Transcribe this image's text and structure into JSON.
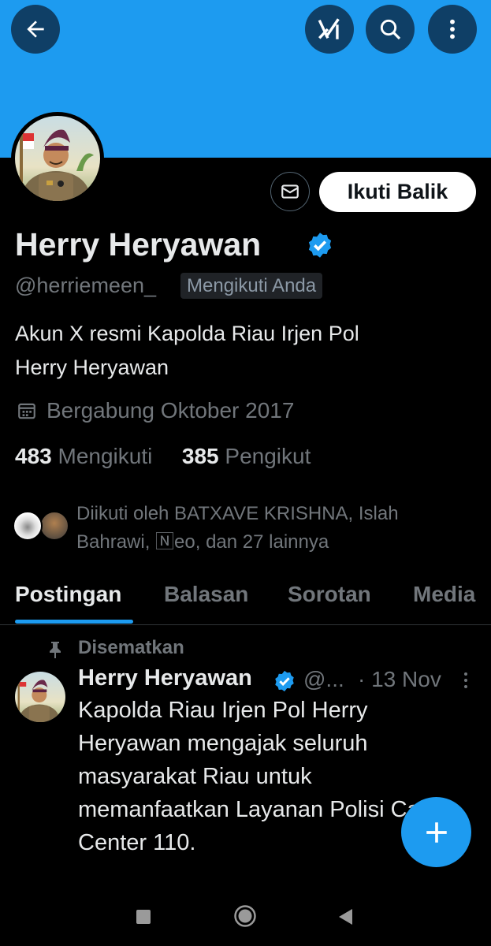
{
  "header": {
    "back_icon": "arrow-left-icon",
    "grok_icon": "grok-icon",
    "search_icon": "search-icon",
    "more_icon": "more-vertical-icon",
    "banner_color": "#1d9bf0"
  },
  "profile": {
    "name": "Herry Heryawan",
    "handle": "@herriemeen_",
    "follows_you_badge": "Mengikuti Anda",
    "follow_back_label": "Ikuti Balik",
    "bio_line1": "Akun X resmi Kapolda Riau Irjen Pol",
    "bio_line2": "Herry Heryawan",
    "joined": "Bergabung Oktober 2017",
    "following_count": "483",
    "following_label": "Mengikuti",
    "followers_count": "385",
    "followers_label": "Pengikut",
    "followed_by_line1": "Diikuti oleh BATXAVE KRISHNA, Islah",
    "followed_by_line2": "Bahrawi, 🄽eo, dan 27 lainnya"
  },
  "tabs": [
    {
      "label": "Postingan",
      "active": true
    },
    {
      "label": "Balasan",
      "active": false
    },
    {
      "label": "Sorotan",
      "active": false
    },
    {
      "label": "Media",
      "active": false
    }
  ],
  "pinned_post": {
    "pinned_label": "Disematkan",
    "author": "Herry Heryawan",
    "handle": "@...",
    "date": "· 13 Nov",
    "text_lines": [
      "Kapolda Riau Irjen Pol Herry",
      "Heryawan mengajak seluruh",
      "masyarakat Riau untuk",
      "memanfaatkan Layanan Polisi Call",
      "Center 110."
    ]
  },
  "colors": {
    "accent": "#1d9bf0",
    "background": "#000000",
    "text_primary": "#e7e9ea",
    "text_secondary": "#71767b"
  }
}
